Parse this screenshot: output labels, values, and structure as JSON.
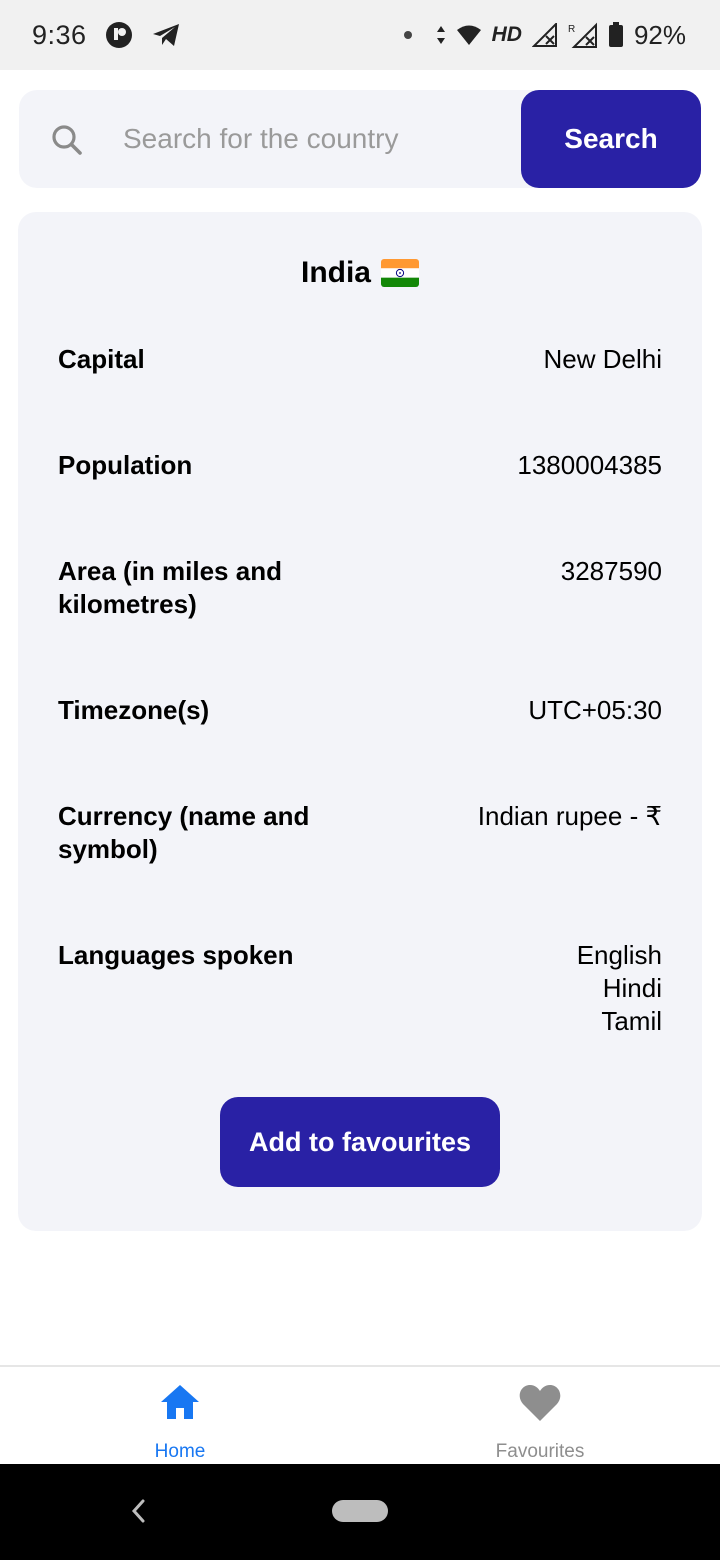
{
  "status_bar": {
    "time": "9:36",
    "network": "HD",
    "battery": "92%"
  },
  "search": {
    "placeholder": "Search for the country",
    "button_label": "Search"
  },
  "country": {
    "name": "India",
    "flag": "flag-india-icon",
    "rows": [
      {
        "label": "Capital",
        "value": "New Delhi"
      },
      {
        "label": "Population",
        "value": "1380004385"
      },
      {
        "label": "Area (in miles and kilometres)",
        "value": "3287590"
      },
      {
        "label": "Timezone(s)",
        "value": "UTC+05:30"
      },
      {
        "label": "Currency (name and symbol)",
        "value": "Indian rupee - ₹"
      },
      {
        "label": "Languages spoken",
        "values": [
          "English",
          "Hindi",
          "Tamil"
        ]
      }
    ],
    "favourite_button_label": "Add to favourites"
  },
  "bottom_nav": {
    "tabs": [
      {
        "label": "Home",
        "icon": "home-icon",
        "active": true
      },
      {
        "label": "Favourites",
        "icon": "heart-icon",
        "active": false
      }
    ]
  },
  "colors": {
    "primary": "#2921a5",
    "active_tab": "#1877f2",
    "inactive_tab": "#8e8e8e",
    "card_background": "#f3f4f9"
  }
}
